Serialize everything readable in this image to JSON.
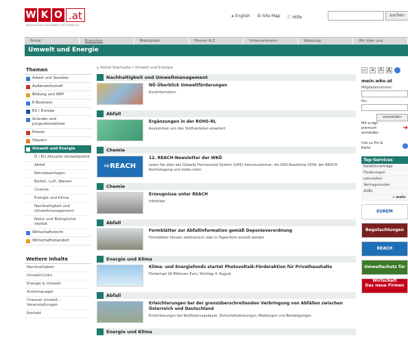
{
  "header": {
    "logo_letters": [
      "W",
      "K",
      "O"
    ],
    "logo_suffix": ".at",
    "logo_subtitle": "WIRTSCHAFTSKAMMER ÖSTERREICH",
    "links": [
      "▸ English",
      "⁂ Site Map",
      "ⓘ Hilfe"
    ],
    "search_button": "suchen"
  },
  "nav": [
    "Portal",
    "Branchen",
    "Marktplatz",
    "Firmen A-Z",
    "Unternehmerin",
    "Webshop",
    "Wir über uns"
  ],
  "section_title": "Umwelt und Energie",
  "sidebar": {
    "heading": "Themen",
    "items": [
      {
        "label": "Arbeit und Soziales",
        "color": "#3a7bd5"
      },
      {
        "label": "Außenwirtschaft",
        "color": "#c0392b"
      },
      {
        "label": "Bildung und WIFI",
        "color": "#e6a02a"
      },
      {
        "label": "E-Business",
        "color": "#3a7bd5"
      },
      {
        "label": "EU / Europa",
        "color": "#1f4f9a"
      },
      {
        "label": "Gründer und Jungunternehmer",
        "color": "#3a7bd5"
      },
      {
        "label": "Presse",
        "color": "#c0392b"
      },
      {
        "label": "Steuern",
        "color": "#e67e22"
      }
    ],
    "active": "Umwelt und Energie",
    "subitems": [
      "Ö / EU Aktuelle Umweltpolitik",
      "Abfall",
      "Betriebsanlagen",
      "Boden, Luft, Wasser",
      "Chemie",
      "Energie und Klima",
      "Nachhaltigkeit und Umweltmanagement",
      "Natur und Biologische Vielfalt"
    ],
    "after": [
      {
        "label": "Wirtschaftsrecht",
        "color": "#3a7bd5"
      },
      {
        "label": "Wirtschaftsstandort",
        "color": "#e6a02a"
      }
    ],
    "heading2": "Weitere Inhalte",
    "more": [
      "Nachhaltigkeit",
      "Umwelt-Links",
      "Energie & Umwelt",
      "Amtsmanager",
      "Channel Umwelt - Veranstaltungen",
      "Kontakt"
    ]
  },
  "breadcrumb": "⌂ Portal-Startseite / Umwelt und Energie",
  "entries": [
    {
      "band": "Nachhaltigkeit und Umweltmanagement",
      "title": "NÖ Überblick Umweltförderungen",
      "desc": "Kurzinformation",
      "thumb": "money"
    },
    {
      "band": "Abfall",
      "title": "Ergänzungen in der ROHS-RL",
      "desc": "Ausnahmen von den Stoffverboten erweitert",
      "thumb": "green"
    },
    {
      "band": "Chemie",
      "title": "12. REACH-Newsletter der WKÖ",
      "desc": "Lesen Sie über das Globally Harmonized System (GHS)-Intensivseminar, die GHS-Roadshow 2009, der REACH-Rechtstagung und vieles mehr.",
      "thumb": "reach"
    },
    {
      "band": "Chemie",
      "title": "Erzeugnisse unter REACH",
      "desc": "Infofolder",
      "thumb": "lab"
    },
    {
      "band": "Abfall",
      "title": "Formblätter zur Abfallinformation gemäß Deponieverordnung",
      "desc": "Formblätter können elektronisch oder in Papierform erstellt werden",
      "thumb": "waste"
    },
    {
      "band": "Energie und Klima",
      "title": "Klima- und Energiefonds startet Photovoltaik-Förderaktion für Privathaushalte",
      "desc": "Fördertopf 18 Millionen Euro, Stichtag 4. August",
      "thumb": "sky"
    },
    {
      "band": "Abfall",
      "title": "Erleichterungen bei der grenzüberschreitenden Verbringung von Abfällen zwischen Österreich und Deutschland",
      "desc": "Erleichterungen bei Notifizierungsdauer, Sicherheitsleistungen, Meldungen und Bestätigungen",
      "thumb": "truck"
    }
  ],
  "last_band": "Energie und Klima",
  "right": {
    "font_sizes": [
      "A",
      "A",
      "A"
    ],
    "mein_title": "mein.wko.at",
    "member_label": "Mitgliedsnummer:",
    "pin_label": "Pin:",
    "login_button": "anmelden",
    "signature_link": "Mit a-sign premium anmelden",
    "info_link": "Info zu Pin & Karte",
    "top_services_title": "Top-Services",
    "top_services": [
      "Kollektivverträge",
      "Förderungen",
      "Lehrstellen",
      "Vertragsmuster",
      "AGBs"
    ],
    "more": "» mehr",
    "banners": [
      {
        "label": "EUREM",
        "color": "#ffffff",
        "text": "#1f5aa0"
      },
      {
        "label": "Begutachtungen",
        "color": "#7a2020",
        "text": "#ffffff"
      },
      {
        "label": "REACH",
        "color": "#1f6fb5",
        "text": "#ffffff"
      },
      {
        "label": "Umweltschutz für Wirtschaft",
        "color": "#3a7a2a",
        "text": "#ffffff"
      },
      {
        "label": "Das neue Firmen A-Z",
        "color": "#c4001a",
        "text": "#ffffff"
      }
    ]
  }
}
